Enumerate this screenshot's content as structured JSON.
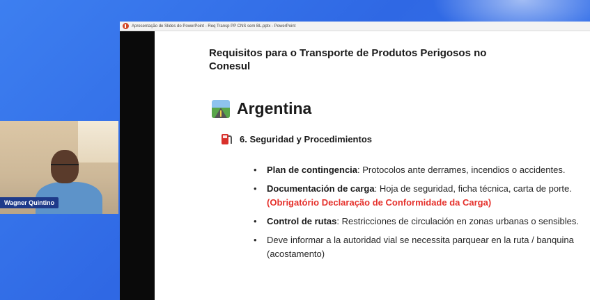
{
  "participant": {
    "name": "Wagner Quintino"
  },
  "window": {
    "title": "Apresentação de Slides do PowerPoint  -  Req Transp PP CNS sem BL.pptx - PowerPoint",
    "app_icon": "powerpoint-icon"
  },
  "slide": {
    "title": "Requisitos para o Transporte de Produtos Perigosos no Conesul",
    "country": {
      "icon": "motorway-icon",
      "name": "Argentina"
    },
    "section": {
      "icon": "fuel-pump-icon",
      "title": "6. Seguridad y Procedimientos"
    },
    "bullets": [
      {
        "label": "Plan de contingencia",
        "text": ": Protocolos ante derrames, incendios o accidentes."
      },
      {
        "label": "Documentación de carga",
        "text": ": Hoja de seguridad, ficha técnica, carta de porte. ",
        "highlight": "(Obrigatório Declaração de Conformidade da Carga)"
      },
      {
        "label": "Control de rutas",
        "text": ": Restricciones de circulación en zonas urbanas o sensibles."
      },
      {
        "label": "",
        "text": "Deve informar a la autoridad vial se necessita parquear en la ruta / banquina (acostamento)"
      }
    ]
  },
  "colors": {
    "background": "#3377ee",
    "highlight_red": "#e5322d",
    "name_tag": "#1e3a8a"
  }
}
